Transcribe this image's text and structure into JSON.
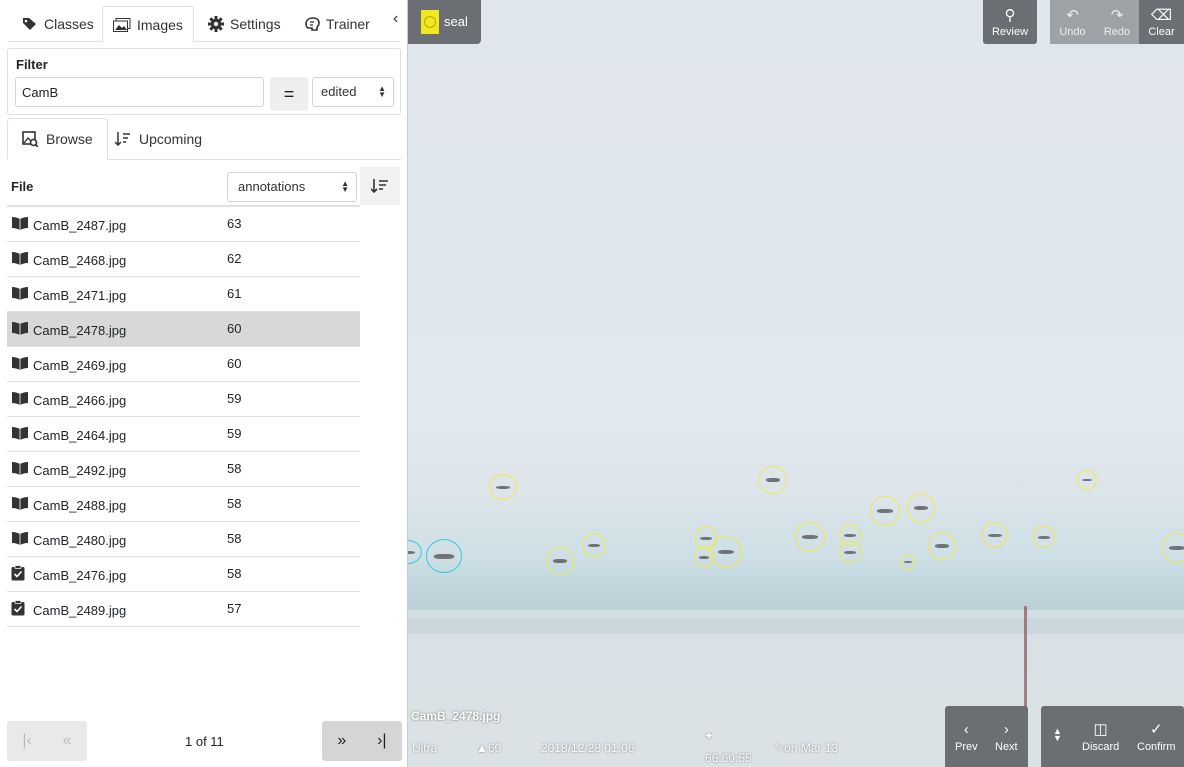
{
  "tabs": [
    {
      "label": "Classes",
      "icon": "tags-icon"
    },
    {
      "label": "Images",
      "icon": "images-icon"
    },
    {
      "label": "Settings",
      "icon": "gear-icon"
    },
    {
      "label": "Trainer",
      "icon": "brain-icon"
    }
  ],
  "active_tab": "Images",
  "filter": {
    "title": "Filter",
    "value": "CamB",
    "operator": "=",
    "field": "edited"
  },
  "subtabs": [
    {
      "label": "Browse",
      "icon": "image-search-icon"
    },
    {
      "label": "Upcoming",
      "icon": "sort-numeric-icon"
    }
  ],
  "table": {
    "file_header": "File",
    "sort_by": "annotations",
    "rows": [
      {
        "file": "CamB_2487.jpg",
        "count": "63",
        "status": "open-book-icon"
      },
      {
        "file": "CamB_2468.jpg",
        "count": "62",
        "status": "open-book-icon"
      },
      {
        "file": "CamB_2471.jpg",
        "count": "61",
        "status": "open-book-icon"
      },
      {
        "file": "CamB_2478.jpg",
        "count": "60",
        "status": "open-book-icon",
        "selected": true
      },
      {
        "file": "CamB_2469.jpg",
        "count": "60",
        "status": "open-book-icon"
      },
      {
        "file": "CamB_2466.jpg",
        "count": "59",
        "status": "open-book-icon"
      },
      {
        "file": "CamB_2464.jpg",
        "count": "59",
        "status": "open-book-icon"
      },
      {
        "file": "CamB_2492.jpg",
        "count": "58",
        "status": "open-book-icon"
      },
      {
        "file": "CamB_2488.jpg",
        "count": "58",
        "status": "open-book-icon"
      },
      {
        "file": "CamB_2480.jpg",
        "count": "58",
        "status": "open-book-icon"
      },
      {
        "file": "CamB_2476.jpg",
        "count": "58",
        "status": "clipboard-check-icon"
      },
      {
        "file": "CamB_2489.jpg",
        "count": "57",
        "status": "clipboard-check-icon"
      }
    ]
  },
  "pager": {
    "text": "1 of 11"
  },
  "viewer": {
    "class_label": "seal",
    "class_color": "#f3e81f",
    "toolbar": {
      "review": "Review",
      "undo": "Undo",
      "redo": "Redo",
      "clear": "Clear"
    },
    "filename": "CamB_2478.jpg",
    "meta": {
      "category": "Ultra",
      "count": "60",
      "date": "2018/12/28 01:06",
      "duration": "66:60:55",
      "edited": "on Mar 13"
    },
    "nav": {
      "prev": "Prev",
      "next": "Next",
      "discard": "Discard",
      "confirm": "Confirm"
    }
  }
}
